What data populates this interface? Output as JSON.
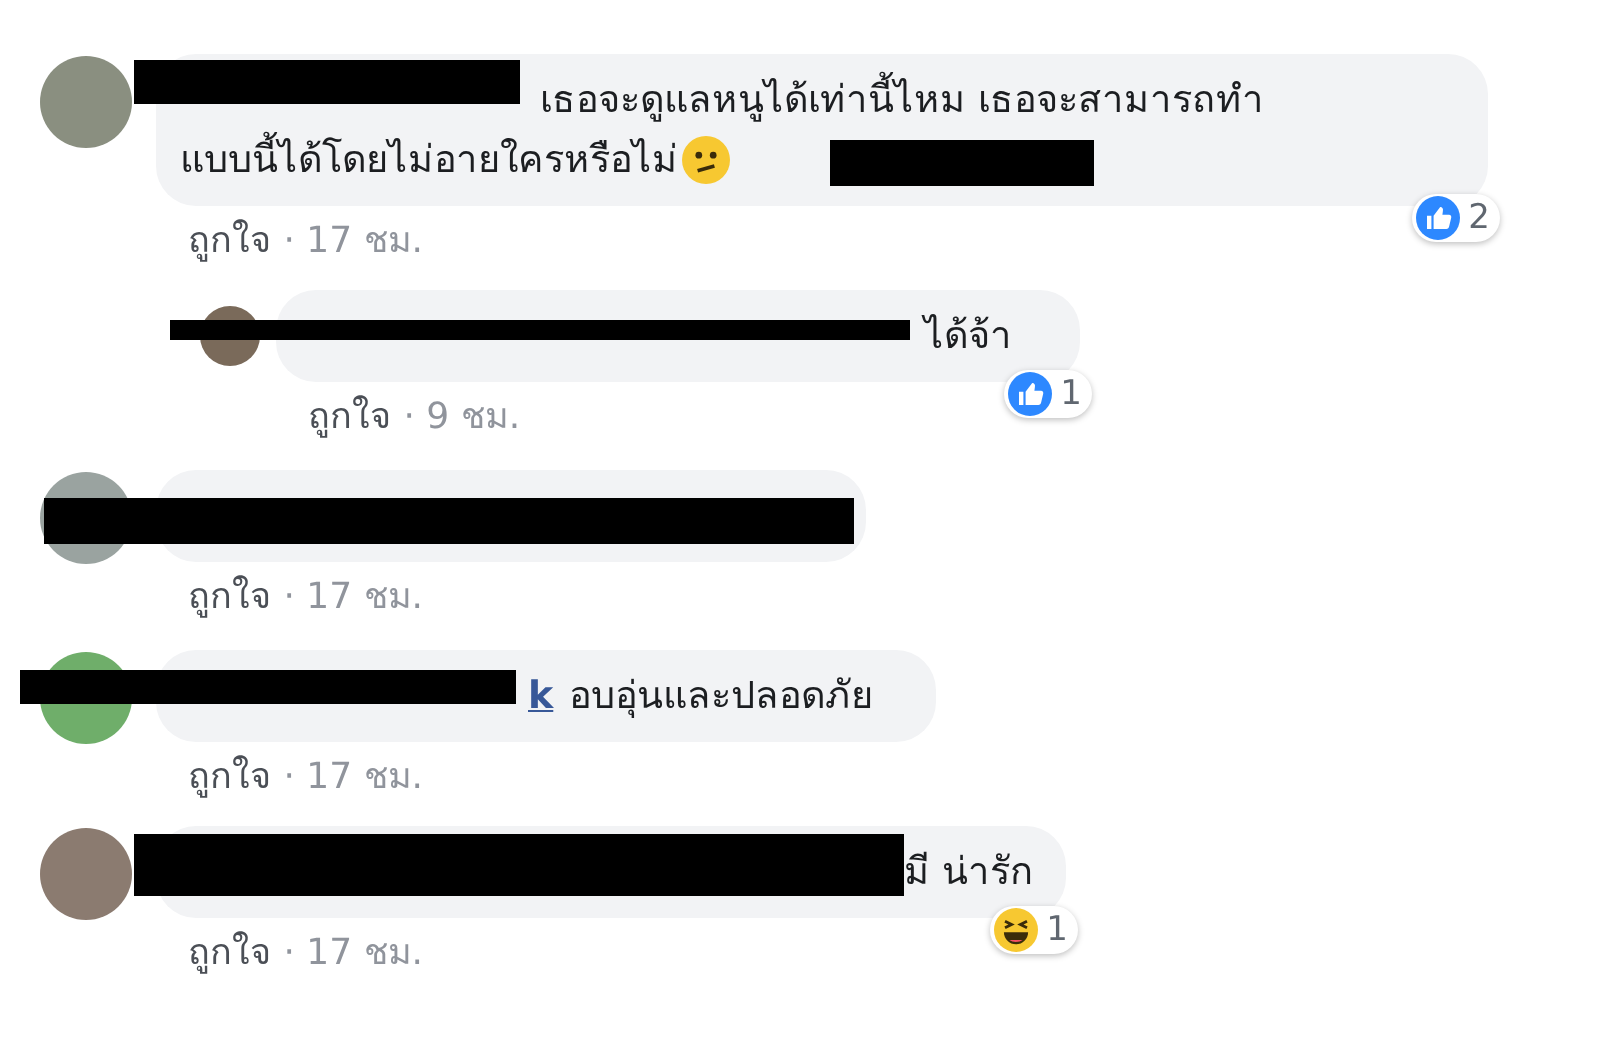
{
  "comments": [
    {
      "kind": "comment",
      "lines": [
        "เธอจะดูแลหนูได้เท่านี้ไหม เธอจะสามารถทำ",
        "แบบนี้ได้โดยไม่อายใครหรือไม่"
      ],
      "emoji": {
        "kind": "confused"
      },
      "reaction": {
        "kind": "like",
        "count": "2"
      },
      "like": "ถูกใจ",
      "time": "· 17 ชม."
    },
    {
      "kind": "reply",
      "lines": [
        "ได้จ้า"
      ],
      "reaction": {
        "kind": "like",
        "count": "1"
      },
      "like": "ถูกใจ",
      "time": "· 9 ชม."
    },
    {
      "kind": "comment",
      "like": "ถูกใจ",
      "time": "· 17 ชม."
    },
    {
      "kind": "comment",
      "author_visible": "k",
      "lines": [
        "อบอุ่นและปลอดภัย"
      ],
      "like": "ถูกใจ",
      "time": "· 17 ชม."
    },
    {
      "kind": "comment",
      "lines": [
        "มี น่ารัก"
      ],
      "reaction": {
        "kind": "haha",
        "count": "1"
      },
      "like": "ถูกใจ",
      "time": "· 17 ชม."
    }
  ]
}
